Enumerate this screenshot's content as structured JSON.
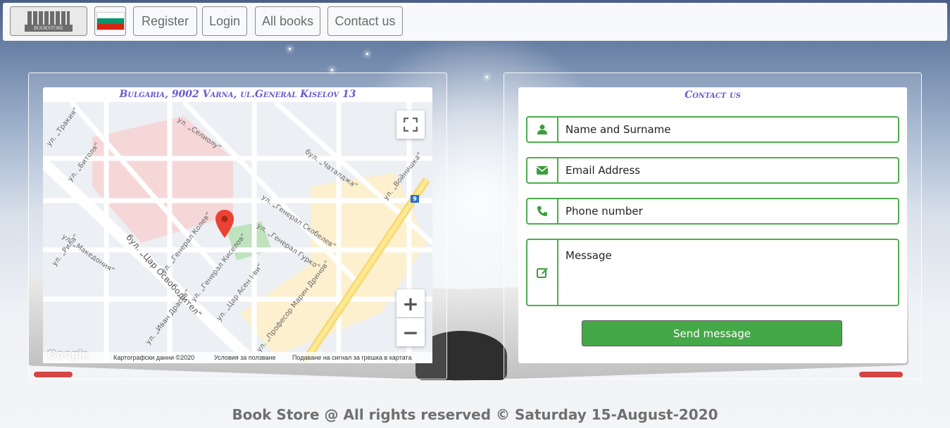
{
  "nav": {
    "logo_text": "BOOKSTORE",
    "flag_colors": [
      "#ffffff",
      "#00966e",
      "#d62612"
    ],
    "links": [
      "Register",
      "Login",
      "All books",
      "Contact us"
    ]
  },
  "map_card": {
    "title": "Bulgaria, 9002 Varna, ul.General Kiselov 13",
    "google_logo": "Google",
    "footer_items": [
      "Картографски данни ©2020",
      "Условия за ползване",
      "Подаване на сигнал за грешка в картата"
    ],
    "street_labels": [
      "бул. „Цар Освободител“",
      "ул. „Генерал Колев“",
      "ул. „Генерал Киселов“",
      "ул. „Цар Асен I-ви“",
      "ул. „Генерал Скобелев“",
      "ул. „Генерал Гурко“",
      "ул. „Професор Марин Дринов“",
      "бул. „Чаталджа“",
      "ул. „Македония“",
      "ул. „Иван Драсов“",
      "ул. „Рила“",
      "ул. „Битоля“",
      "ул. „Тракия“",
      "ул. „Селиолу“",
      "ул. „Войнишка“"
    ],
    "route_badge": "9",
    "zoom_in": "+",
    "zoom_out": "−",
    "fullscreen_icon": "fullscreen-icon"
  },
  "contact_card": {
    "title": "Contact us",
    "fields": [
      {
        "placeholder": "Name and Surname",
        "icon": "user-icon"
      },
      {
        "placeholder": "Email Address",
        "icon": "envelope-icon"
      },
      {
        "placeholder": "Phone number",
        "icon": "phone-icon"
      },
      {
        "placeholder": "Message",
        "icon": "edit-icon"
      }
    ],
    "send_label": "Send message",
    "accent_color": "#45a848"
  },
  "footer": {
    "text": "Book Store @ All rights reserved © Saturday 15-August-2020"
  }
}
